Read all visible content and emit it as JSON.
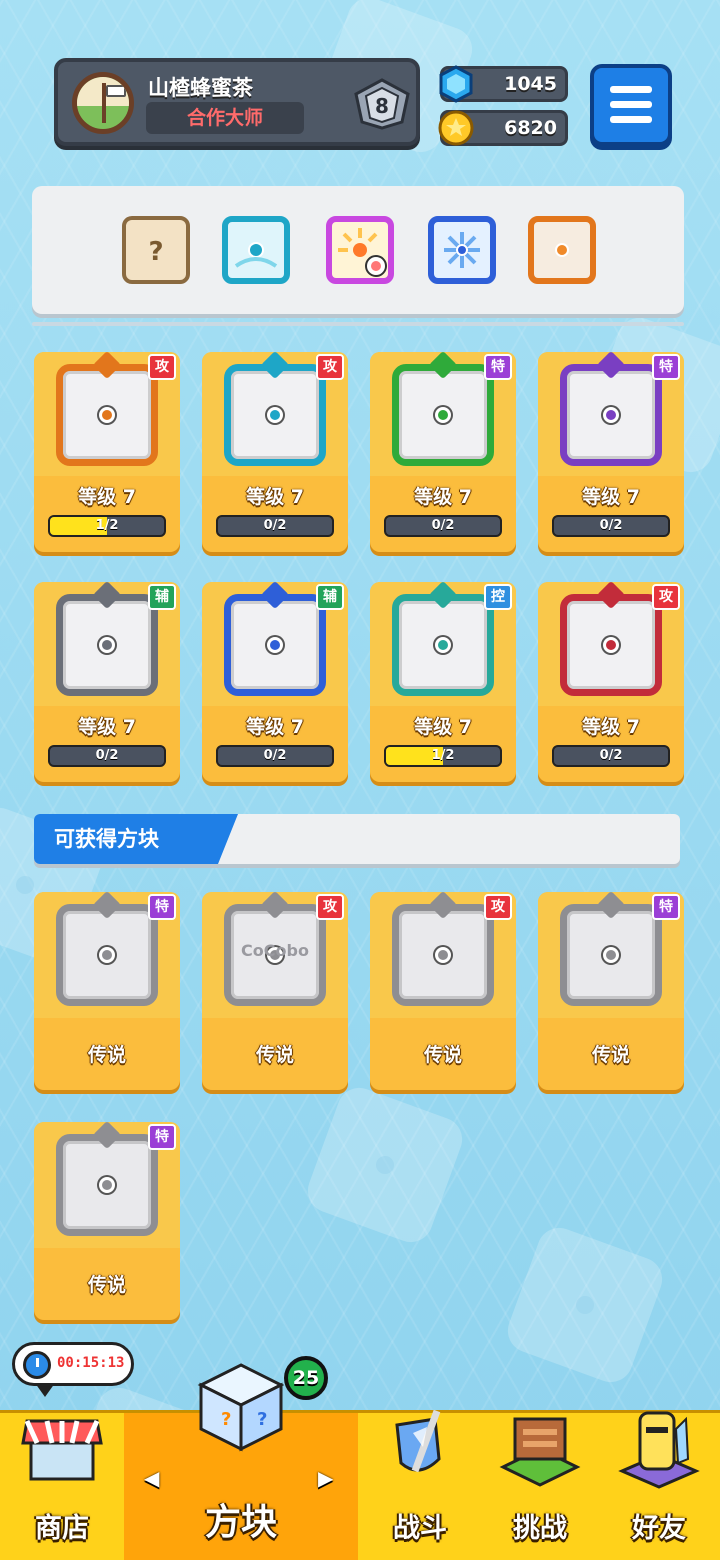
{
  "player": {
    "name": "山楂蜂蜜茶",
    "title": "合作大师",
    "rank": "8"
  },
  "resources": {
    "gems": "1045",
    "coins": "6820"
  },
  "colors": {
    "attack": "#e8333c",
    "special": "#9b3fd6",
    "support": "#22a35a",
    "control": "#2f8fe0",
    "accent": "#1f7fe6",
    "card": "#fbbd3d"
  },
  "loadout": [
    {
      "icon": "mystery-dice-icon"
    },
    {
      "icon": "cyan-dragon-dice-icon"
    },
    {
      "icon": "sun-skin-dice-icon"
    },
    {
      "icon": "ice-dragon-dice-icon"
    },
    {
      "icon": "orange-dragon-dice-icon"
    }
  ],
  "owned": [
    {
      "tag": "攻",
      "level": "等级 7",
      "progress": "1/2",
      "fill": 0.5,
      "color": "#e2761c",
      "icon": "gun-dice-icon"
    },
    {
      "tag": "攻",
      "level": "等级 7",
      "progress": "0/2",
      "fill": 0,
      "color": "#1ea6c7",
      "icon": "whirlpool-dice-icon"
    },
    {
      "tag": "特",
      "level": "等级 7",
      "progress": "0/2",
      "fill": 0,
      "color": "#2faa3a",
      "icon": "grass-dice-icon"
    },
    {
      "tag": "特",
      "level": "等级 7",
      "progress": "0/2",
      "fill": 0,
      "color": "#7a3fc2",
      "icon": "void-dice-icon"
    },
    {
      "tag": "辅",
      "level": "等级 7",
      "progress": "0/2",
      "fill": 0,
      "color": "#6b6f78",
      "icon": "cycle-dice-icon"
    },
    {
      "tag": "辅",
      "level": "等级 7",
      "progress": "0/2",
      "fill": 0,
      "color": "#2e5fd8",
      "icon": "moon-dice-icon"
    },
    {
      "tag": "控",
      "level": "等级 7",
      "progress": "1/2",
      "fill": 0.5,
      "color": "#27a99a",
      "icon": "wind-dice-icon"
    },
    {
      "tag": "攻",
      "level": "等级 7",
      "progress": "0/2",
      "fill": 0,
      "color": "#c22c3a",
      "icon": "vortex-dice-icon"
    }
  ],
  "available": {
    "header": "可获得方块",
    "items": [
      {
        "tag": "特",
        "label": "传说",
        "icon": "sword-dice-icon"
      },
      {
        "tag": "攻",
        "label": "传说",
        "icon": "combo-dice-icon",
        "text": "CoCobo"
      },
      {
        "tag": "攻",
        "label": "传说",
        "icon": "star-dice-icon"
      },
      {
        "tag": "特",
        "label": "传说",
        "icon": "emblem-dice-icon"
      },
      {
        "tag": "特",
        "label": "传说",
        "icon": "heart-dice-icon"
      }
    ]
  },
  "timer": "00:15:13",
  "nav": {
    "shop": "商店",
    "dice": "方块",
    "battle": "战斗",
    "challenge": "挑战",
    "friends": "好友",
    "badge": "25"
  }
}
